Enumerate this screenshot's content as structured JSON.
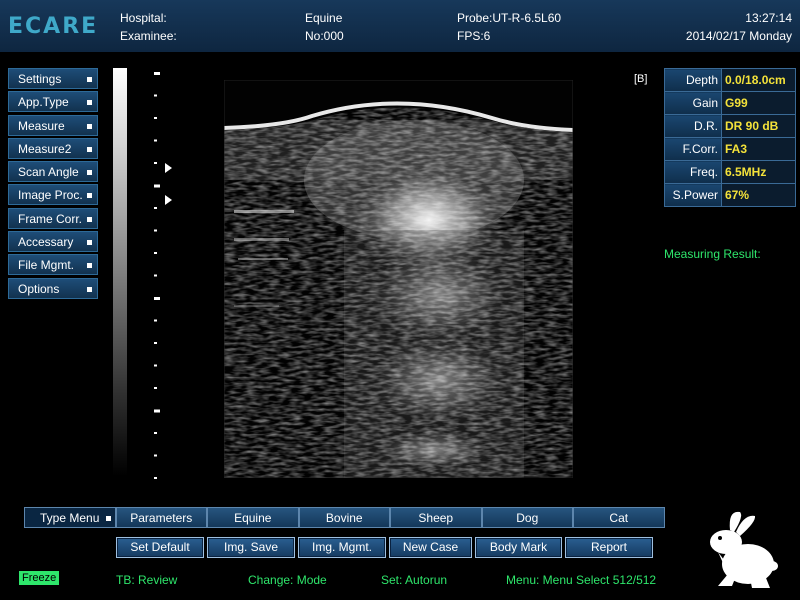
{
  "header": {
    "logo": "ECARE",
    "hospital_label": "Hospital:",
    "examinee_label": "Examinee:",
    "species": "Equine",
    "number": "No:000",
    "probe": "Probe:UT-R-6.5L60",
    "fps": "FPS:6",
    "time": "13:27:14",
    "date": "2014/02/17 Monday"
  },
  "left_menu": [
    {
      "label": "Settings"
    },
    {
      "label": "App.Type"
    },
    {
      "label": "Measure"
    },
    {
      "label": "Measure2"
    },
    {
      "label": "Scan Angle"
    },
    {
      "label": "Image Proc."
    },
    {
      "label": "Frame Corr."
    },
    {
      "label": "Accessary"
    },
    {
      "label": "File Mgmt."
    },
    {
      "label": "Options"
    }
  ],
  "image_tag": "[B]",
  "params": [
    {
      "label": "Depth",
      "value": "0.0/18.0cm"
    },
    {
      "label": "Gain",
      "value": "G99"
    },
    {
      "label": "D.R.",
      "value": "DR 90 dB"
    },
    {
      "label": "F.Corr.",
      "value": "FA3"
    },
    {
      "label": "Freq.",
      "value": "6.5MHz"
    },
    {
      "label": "S.Power",
      "value": "67%"
    }
  ],
  "measuring_result": "Measuring Result:",
  "tabs": [
    "Type Menu",
    "Parameters",
    "Equine",
    "Bovine",
    "Sheep",
    "Dog",
    "Cat"
  ],
  "buttons": [
    "Set Default",
    "Img. Save",
    "Img. Mgmt.",
    "New Case",
    "Body Mark",
    "Report"
  ],
  "status": {
    "freeze": "Freeze",
    "tb": "TB: Review",
    "change": "Change: Mode",
    "set": "Set: Autorun",
    "menu": "Menu: Menu Select  512/512"
  },
  "colors": {
    "status_green": "#2ee66b",
    "param_value": "#f4e23a",
    "panel_blue": "#17385a"
  }
}
